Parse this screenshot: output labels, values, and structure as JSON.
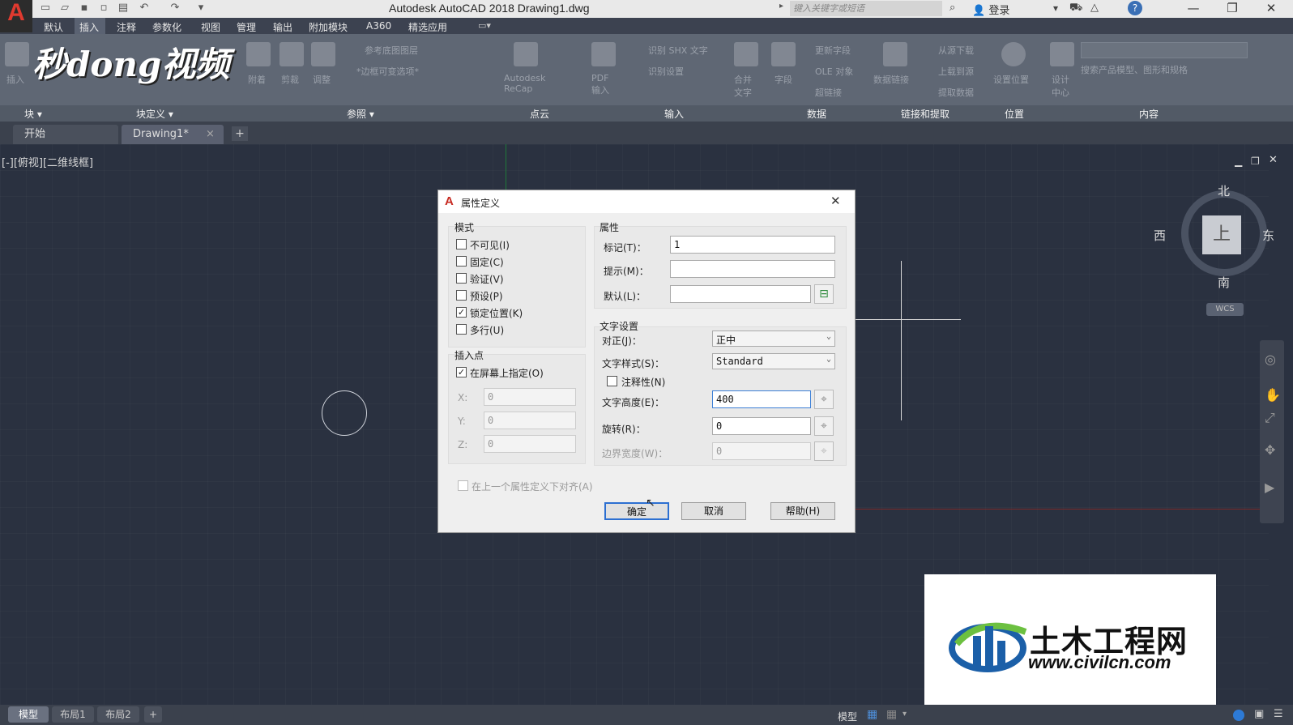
{
  "app": {
    "logo_letter": "A",
    "window_title": "Autodesk AutoCAD 2018    Drawing1.dwg",
    "search_placeholder": "键入关键字或短语",
    "login_label": "登录"
  },
  "menu": [
    "默认",
    "插入",
    "注释",
    "参数化",
    "视图",
    "管理",
    "输出",
    "附加模块",
    "A360",
    "精选应用"
  ],
  "ribbon": {
    "panels": [
      "块",
      "块定义",
      "参照",
      "点云",
      "输入",
      "数据",
      "链接和提取",
      "位置",
      "内容"
    ],
    "buttons": {
      "insert": "插入",
      "attach": "附着",
      "clip": "剪裁",
      "adjust": "调整",
      "recap": "Autodesk ReCap",
      "pdf_import": "PDF 输入",
      "merge_text": "合并文字",
      "field": "字段",
      "data_link": "数据链接",
      "set_location": "设置位置",
      "design_center": "设计中心",
      "underlay_layers": "参考底图图层",
      "frames": "*边框可变选项*",
      "recognize_shx": "识别 SHX 文字",
      "recognize_settings": "识别设置",
      "update_field": "更新字段",
      "ole_object": "OLE 对象",
      "hyperlink": "超链接",
      "download_source": "从源下载",
      "upload_source": "上载到源",
      "extract_data": "提取数据",
      "content_search": "搜索产品模型、图形和规格"
    }
  },
  "tabs": {
    "start": "开始",
    "drawing": "Drawing1*",
    "close": "×",
    "add": "+"
  },
  "viewport": {
    "label": "[-][俯视][二维线框]"
  },
  "viewcube": {
    "north": "北",
    "south": "南",
    "east": "东",
    "west": "西",
    "top": "上",
    "wcs": "WCS"
  },
  "dialog": {
    "title": "属性定义",
    "close": "✕",
    "mode_group": "模式",
    "modes": [
      {
        "label": "不可见(I)",
        "checked": false
      },
      {
        "label": "固定(C)",
        "checked": false
      },
      {
        "label": "验证(V)",
        "checked": false
      },
      {
        "label": "预设(P)",
        "checked": false
      },
      {
        "label": "锁定位置(K)",
        "checked": true
      },
      {
        "label": "多行(U)",
        "checked": false
      }
    ],
    "insertion_group": "插入点",
    "specify_on_screen": "在屏幕上指定(O)",
    "x_label": "X:",
    "y_label": "Y:",
    "z_label": "Z:",
    "x_value": "0",
    "y_value": "0",
    "z_value": "0",
    "attribute_group": "属性",
    "tag_label": "标记(T)：",
    "tag_value": "1",
    "prompt_label": "提示(M)：",
    "prompt_value": "",
    "default_label": "默认(L)：",
    "default_value": "",
    "text_group": "文字设置",
    "justify_label": "对正(J)：",
    "justify_value": "正中",
    "style_label": "文字样式(S)：",
    "style_value": "Standard",
    "annotative_label": "注释性(N)",
    "height_label": "文字高度(E)：",
    "height_value": "400",
    "rotation_label": "旋转(R)：",
    "rotation_value": "0",
    "boundary_label": "边界宽度(W)：",
    "boundary_value": "0",
    "align_below": "在上一个属性定义下对齐(A)",
    "ok": "确定",
    "cancel": "取消",
    "help": "帮助(H)"
  },
  "layout_tabs": [
    "模型",
    "布局1",
    "布局2",
    "+"
  ],
  "status": {
    "model": "模型"
  },
  "watermarks": {
    "top_left": "秒dong视频",
    "brand_cn": "土木工程网",
    "brand_url": "www.civilcn.com"
  }
}
